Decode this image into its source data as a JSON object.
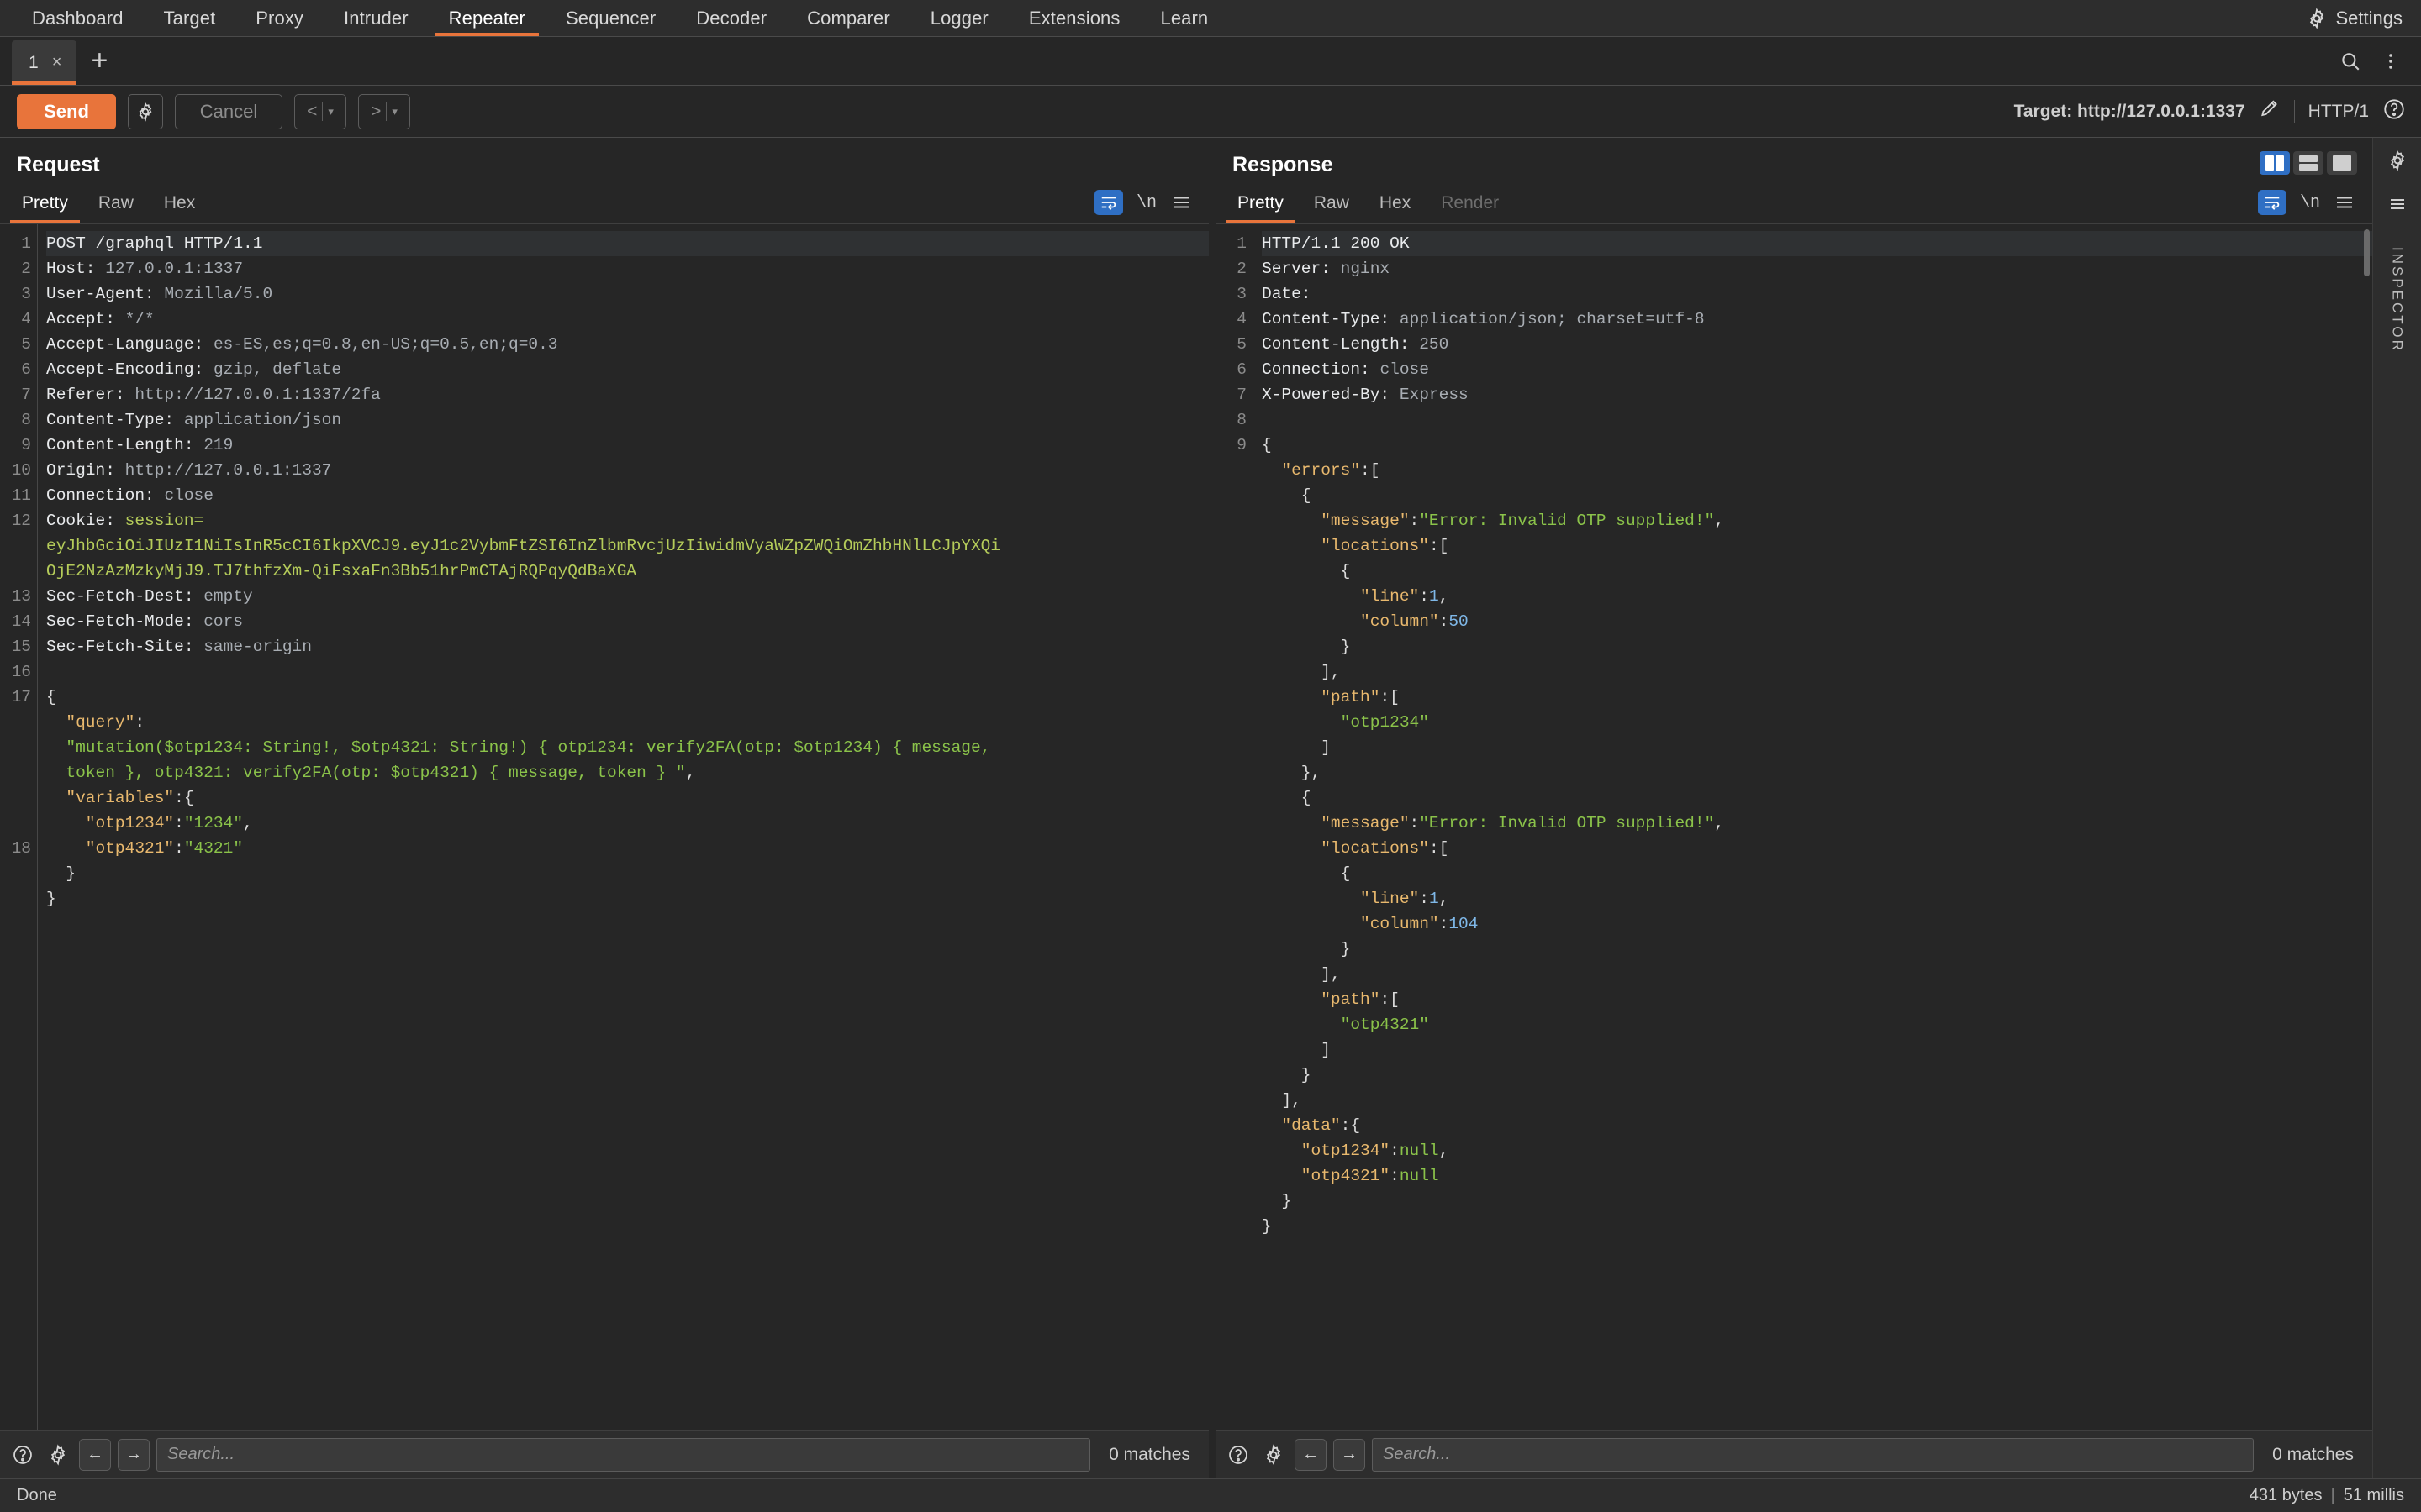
{
  "topnav": {
    "tabs": [
      {
        "label": "Dashboard",
        "active": false
      },
      {
        "label": "Target",
        "active": false
      },
      {
        "label": "Proxy",
        "active": false
      },
      {
        "label": "Intruder",
        "active": false
      },
      {
        "label": "Repeater",
        "active": true
      },
      {
        "label": "Sequencer",
        "active": false
      },
      {
        "label": "Decoder",
        "active": false
      },
      {
        "label": "Comparer",
        "active": false
      },
      {
        "label": "Logger",
        "active": false
      },
      {
        "label": "Extensions",
        "active": false
      },
      {
        "label": "Learn",
        "active": false
      }
    ],
    "settings_label": "Settings",
    "settings_icon": "gear-icon"
  },
  "tabstrip": {
    "tab_label": "1",
    "tab_close": "×",
    "add_label": "+",
    "search_icon": "search-icon",
    "menu_icon": "kebab-menu-icon"
  },
  "actionbar": {
    "send_label": "Send",
    "send_settings_icon": "gear-icon",
    "cancel_label": "Cancel",
    "prev_label": "<",
    "next_label": ">",
    "caret": "▾",
    "target_label": "Target: http://127.0.0.1:1337",
    "edit_icon": "pencil-icon",
    "http_version": "HTTP/1",
    "help_icon": "question-circle-icon"
  },
  "request": {
    "title": "Request",
    "tabs": [
      {
        "label": "Pretty",
        "active": true,
        "disabled": false
      },
      {
        "label": "Raw",
        "active": false,
        "disabled": false
      },
      {
        "label": "Hex",
        "active": false,
        "disabled": false
      }
    ],
    "wrap_icon": "word-wrap-icon",
    "newline_label": "\\n",
    "menu_icon": "hamburger-menu-icon",
    "lines": [
      {
        "n": "1",
        "segs": [
          {
            "t": "POST /graphql HTTP/1.1",
            "c": "hk"
          }
        ]
      },
      {
        "n": "2",
        "segs": [
          {
            "t": "Host: ",
            "c": "hk"
          },
          {
            "t": "127.0.0.1:1337",
            "c": "hv"
          }
        ]
      },
      {
        "n": "3",
        "segs": [
          {
            "t": "User-Agent: ",
            "c": "hk"
          },
          {
            "t": "Mozilla/5.0",
            "c": "hv"
          }
        ]
      },
      {
        "n": "4",
        "segs": [
          {
            "t": "Accept: ",
            "c": "hk"
          },
          {
            "t": "*/*",
            "c": "hv"
          }
        ]
      },
      {
        "n": "5",
        "segs": [
          {
            "t": "Accept-Language: ",
            "c": "hk"
          },
          {
            "t": "es-ES,es;q=0.8,en-US;q=0.5,en;q=0.3",
            "c": "hv"
          }
        ]
      },
      {
        "n": "6",
        "segs": [
          {
            "t": "Accept-Encoding: ",
            "c": "hk"
          },
          {
            "t": "gzip, deflate",
            "c": "hv"
          }
        ]
      },
      {
        "n": "7",
        "segs": [
          {
            "t": "Referer: ",
            "c": "hk"
          },
          {
            "t": "http://127.0.0.1:1337/2fa",
            "c": "hv"
          }
        ]
      },
      {
        "n": "8",
        "segs": [
          {
            "t": "Content-Type: ",
            "c": "hk"
          },
          {
            "t": "application/json",
            "c": "hv"
          }
        ]
      },
      {
        "n": "9",
        "segs": [
          {
            "t": "Content-Length: ",
            "c": "hk"
          },
          {
            "t": "219",
            "c": "hv"
          }
        ]
      },
      {
        "n": "10",
        "segs": [
          {
            "t": "Origin: ",
            "c": "hk"
          },
          {
            "t": "http://127.0.0.1:1337",
            "c": "hv"
          }
        ]
      },
      {
        "n": "11",
        "segs": [
          {
            "t": "Connection: ",
            "c": "hk"
          },
          {
            "t": "close",
            "c": "hv"
          }
        ]
      },
      {
        "n": "12",
        "segs": [
          {
            "t": "Cookie: ",
            "c": "hk"
          },
          {
            "t": "session=",
            "c": "jwt"
          }
        ]
      },
      {
        "n": "",
        "segs": [
          {
            "t": "eyJhbGciOiJIUzI1NiIsInR5cCI6IkpXVCJ9.eyJ1c2VybmFtZSI6InZlbmRvcjUzIiwidmVyaWZpZWQiOmZhbHNlLCJpYXQi",
            "c": "jwt"
          }
        ]
      },
      {
        "n": "",
        "segs": [
          {
            "t": "OjE2NzAzMzkyMjJ9.TJ7thfzXm-QiFsxaFn3Bb51hrPmCTAjRQPqyQdBaXGA",
            "c": "jwt"
          }
        ]
      },
      {
        "n": "13",
        "segs": [
          {
            "t": "Sec-Fetch-Dest: ",
            "c": "hk"
          },
          {
            "t": "empty",
            "c": "hv"
          }
        ]
      },
      {
        "n": "14",
        "segs": [
          {
            "t": "Sec-Fetch-Mode: ",
            "c": "hk"
          },
          {
            "t": "cors",
            "c": "hv"
          }
        ]
      },
      {
        "n": "15",
        "segs": [
          {
            "t": "Sec-Fetch-Site: ",
            "c": "hk"
          },
          {
            "t": "same-origin",
            "c": "hv"
          }
        ]
      },
      {
        "n": "16",
        "segs": [
          {
            "t": "",
            "c": "punct"
          }
        ]
      },
      {
        "n": "17",
        "segs": [
          {
            "t": "{",
            "c": "punct"
          }
        ]
      },
      {
        "n": "",
        "segs": [
          {
            "t": "  \"query\"",
            "c": "jk"
          },
          {
            "t": ":",
            "c": "punct"
          }
        ]
      },
      {
        "n": "",
        "segs": [
          {
            "t": "  \"mutation($otp1234: String!, $otp4321: String!) { otp1234: verify2FA(otp: $otp1234) { message,",
            "c": "js"
          }
        ]
      },
      {
        "n": "",
        "segs": [
          {
            "t": "  token }, otp4321: verify2FA(otp: $otp4321) { message, token } \"",
            "c": "js"
          },
          {
            "t": ",",
            "c": "punct"
          }
        ]
      },
      {
        "n": "",
        "segs": [
          {
            "t": "  \"variables\"",
            "c": "jk"
          },
          {
            "t": ":{",
            "c": "punct"
          }
        ]
      },
      {
        "n": "",
        "segs": [
          {
            "t": "    \"otp1234\"",
            "c": "jk"
          },
          {
            "t": ":",
            "c": "punct"
          },
          {
            "t": "\"1234\"",
            "c": "js"
          },
          {
            "t": ",",
            "c": "punct"
          }
        ]
      },
      {
        "n": "18",
        "segs": [
          {
            "t": "    \"otp4321\"",
            "c": "jk"
          },
          {
            "t": ":",
            "c": "punct"
          },
          {
            "t": "\"4321\"",
            "c": "js"
          }
        ]
      },
      {
        "n": "",
        "segs": [
          {
            "t": "  }",
            "c": "punct"
          }
        ]
      },
      {
        "n": "",
        "segs": [
          {
            "t": "}",
            "c": "punct"
          }
        ]
      }
    ],
    "search_placeholder": "Search...",
    "matches_label": "0 matches",
    "help_icon": "question-circle-icon",
    "settings_icon": "gear-icon",
    "back_icon": "arrow-left-icon",
    "forward_icon": "arrow-right-icon"
  },
  "response": {
    "title": "Response",
    "tabs": [
      {
        "label": "Pretty",
        "active": true,
        "disabled": false
      },
      {
        "label": "Raw",
        "active": false,
        "disabled": false
      },
      {
        "label": "Hex",
        "active": false,
        "disabled": false
      },
      {
        "label": "Render",
        "active": false,
        "disabled": true
      }
    ],
    "wrap_icon": "word-wrap-icon",
    "newline_label": "\\n",
    "menu_icon": "hamburger-menu-icon",
    "layout_icons": [
      "split-vertical-icon",
      "split-horizontal-icon",
      "single-pane-icon"
    ],
    "lines": [
      {
        "n": "1",
        "segs": [
          {
            "t": "HTTP/1.1 200 OK",
            "c": "hk"
          }
        ]
      },
      {
        "n": "2",
        "segs": [
          {
            "t": "Server: ",
            "c": "hk"
          },
          {
            "t": "nginx",
            "c": "hv"
          }
        ]
      },
      {
        "n": "3",
        "segs": [
          {
            "t": "Date: ",
            "c": "hk"
          }
        ]
      },
      {
        "n": "4",
        "segs": [
          {
            "t": "Content-Type: ",
            "c": "hk"
          },
          {
            "t": "application/json; charset=utf-8",
            "c": "hv"
          }
        ]
      },
      {
        "n": "5",
        "segs": [
          {
            "t": "Content-Length: ",
            "c": "hk"
          },
          {
            "t": "250",
            "c": "hv"
          }
        ]
      },
      {
        "n": "6",
        "segs": [
          {
            "t": "Connection: ",
            "c": "hk"
          },
          {
            "t": "close",
            "c": "hv"
          }
        ]
      },
      {
        "n": "7",
        "segs": [
          {
            "t": "X-Powered-By: ",
            "c": "hk"
          },
          {
            "t": "Express",
            "c": "hv"
          }
        ]
      },
      {
        "n": "8",
        "segs": [
          {
            "t": "",
            "c": "punct"
          }
        ]
      },
      {
        "n": "9",
        "segs": [
          {
            "t": "{",
            "c": "punct"
          }
        ]
      },
      {
        "n": "",
        "segs": [
          {
            "t": "  \"errors\"",
            "c": "jk"
          },
          {
            "t": ":[",
            "c": "punct"
          }
        ]
      },
      {
        "n": "",
        "segs": [
          {
            "t": "    {",
            "c": "punct"
          }
        ]
      },
      {
        "n": "",
        "segs": [
          {
            "t": "      \"message\"",
            "c": "jk"
          },
          {
            "t": ":",
            "c": "punct"
          },
          {
            "t": "\"Error: Invalid OTP supplied!\"",
            "c": "js"
          },
          {
            "t": ",",
            "c": "punct"
          }
        ]
      },
      {
        "n": "",
        "segs": [
          {
            "t": "      \"locations\"",
            "c": "jk"
          },
          {
            "t": ":[",
            "c": "punct"
          }
        ]
      },
      {
        "n": "",
        "segs": [
          {
            "t": "        {",
            "c": "punct"
          }
        ]
      },
      {
        "n": "",
        "segs": [
          {
            "t": "          \"line\"",
            "c": "jk"
          },
          {
            "t": ":",
            "c": "punct"
          },
          {
            "t": "1",
            "c": "jn"
          },
          {
            "t": ",",
            "c": "punct"
          }
        ]
      },
      {
        "n": "",
        "segs": [
          {
            "t": "          \"column\"",
            "c": "jk"
          },
          {
            "t": ":",
            "c": "punct"
          },
          {
            "t": "50",
            "c": "jn"
          }
        ]
      },
      {
        "n": "",
        "segs": [
          {
            "t": "        }",
            "c": "punct"
          }
        ]
      },
      {
        "n": "",
        "segs": [
          {
            "t": "      ],",
            "c": "punct"
          }
        ]
      },
      {
        "n": "",
        "segs": [
          {
            "t": "      \"path\"",
            "c": "jk"
          },
          {
            "t": ":[",
            "c": "punct"
          }
        ]
      },
      {
        "n": "",
        "segs": [
          {
            "t": "        ",
            "c": "punct"
          },
          {
            "t": "\"otp1234\"",
            "c": "js"
          }
        ]
      },
      {
        "n": "",
        "segs": [
          {
            "t": "      ]",
            "c": "punct"
          }
        ]
      },
      {
        "n": "",
        "segs": [
          {
            "t": "    },",
            "c": "punct"
          }
        ]
      },
      {
        "n": "",
        "segs": [
          {
            "t": "    {",
            "c": "punct"
          }
        ]
      },
      {
        "n": "",
        "segs": [
          {
            "t": "      \"message\"",
            "c": "jk"
          },
          {
            "t": ":",
            "c": "punct"
          },
          {
            "t": "\"Error: Invalid OTP supplied!\"",
            "c": "js"
          },
          {
            "t": ",",
            "c": "punct"
          }
        ]
      },
      {
        "n": "",
        "segs": [
          {
            "t": "      \"locations\"",
            "c": "jk"
          },
          {
            "t": ":[",
            "c": "punct"
          }
        ]
      },
      {
        "n": "",
        "segs": [
          {
            "t": "        {",
            "c": "punct"
          }
        ]
      },
      {
        "n": "",
        "segs": [
          {
            "t": "          \"line\"",
            "c": "jk"
          },
          {
            "t": ":",
            "c": "punct"
          },
          {
            "t": "1",
            "c": "jn"
          },
          {
            "t": ",",
            "c": "punct"
          }
        ]
      },
      {
        "n": "",
        "segs": [
          {
            "t": "          \"column\"",
            "c": "jk"
          },
          {
            "t": ":",
            "c": "punct"
          },
          {
            "t": "104",
            "c": "jn"
          }
        ]
      },
      {
        "n": "",
        "segs": [
          {
            "t": "        }",
            "c": "punct"
          }
        ]
      },
      {
        "n": "",
        "segs": [
          {
            "t": "      ],",
            "c": "punct"
          }
        ]
      },
      {
        "n": "",
        "segs": [
          {
            "t": "      \"path\"",
            "c": "jk"
          },
          {
            "t": ":[",
            "c": "punct"
          }
        ]
      },
      {
        "n": "",
        "segs": [
          {
            "t": "        ",
            "c": "punct"
          },
          {
            "t": "\"otp4321\"",
            "c": "js"
          }
        ]
      },
      {
        "n": "",
        "segs": [
          {
            "t": "      ]",
            "c": "punct"
          }
        ]
      },
      {
        "n": "",
        "segs": [
          {
            "t": "    }",
            "c": "punct"
          }
        ]
      },
      {
        "n": "",
        "segs": [
          {
            "t": "  ],",
            "c": "punct"
          }
        ]
      },
      {
        "n": "",
        "segs": [
          {
            "t": "  \"data\"",
            "c": "jk"
          },
          {
            "t": ":{",
            "c": "punct"
          }
        ]
      },
      {
        "n": "",
        "segs": [
          {
            "t": "    \"otp1234\"",
            "c": "jk"
          },
          {
            "t": ":",
            "c": "punct"
          },
          {
            "t": "null",
            "c": "js"
          },
          {
            "t": ",",
            "c": "punct"
          }
        ]
      },
      {
        "n": "",
        "segs": [
          {
            "t": "    \"otp4321\"",
            "c": "jk"
          },
          {
            "t": ":",
            "c": "punct"
          },
          {
            "t": "null",
            "c": "js"
          }
        ]
      },
      {
        "n": "",
        "segs": [
          {
            "t": "  }",
            "c": "punct"
          }
        ]
      },
      {
        "n": "",
        "segs": [
          {
            "t": "}",
            "c": "punct"
          }
        ]
      }
    ],
    "search_placeholder": "Search...",
    "matches_label": "0 matches",
    "help_icon": "question-circle-icon",
    "settings_icon": "gear-icon",
    "back_icon": "arrow-left-icon",
    "forward_icon": "arrow-right-icon"
  },
  "inspector": {
    "label": "INSPECTOR",
    "gear_icon": "gear-icon",
    "list_icon": "list-icon"
  },
  "statusbar": {
    "left_text": "Done",
    "bytes": "431 bytes",
    "separator": "|",
    "millis": "51 millis"
  },
  "colors": {
    "accent": "#e8743b",
    "bg": "#262626",
    "panel": "#2d2d2d",
    "selected_blue": "#2f6fc4"
  }
}
